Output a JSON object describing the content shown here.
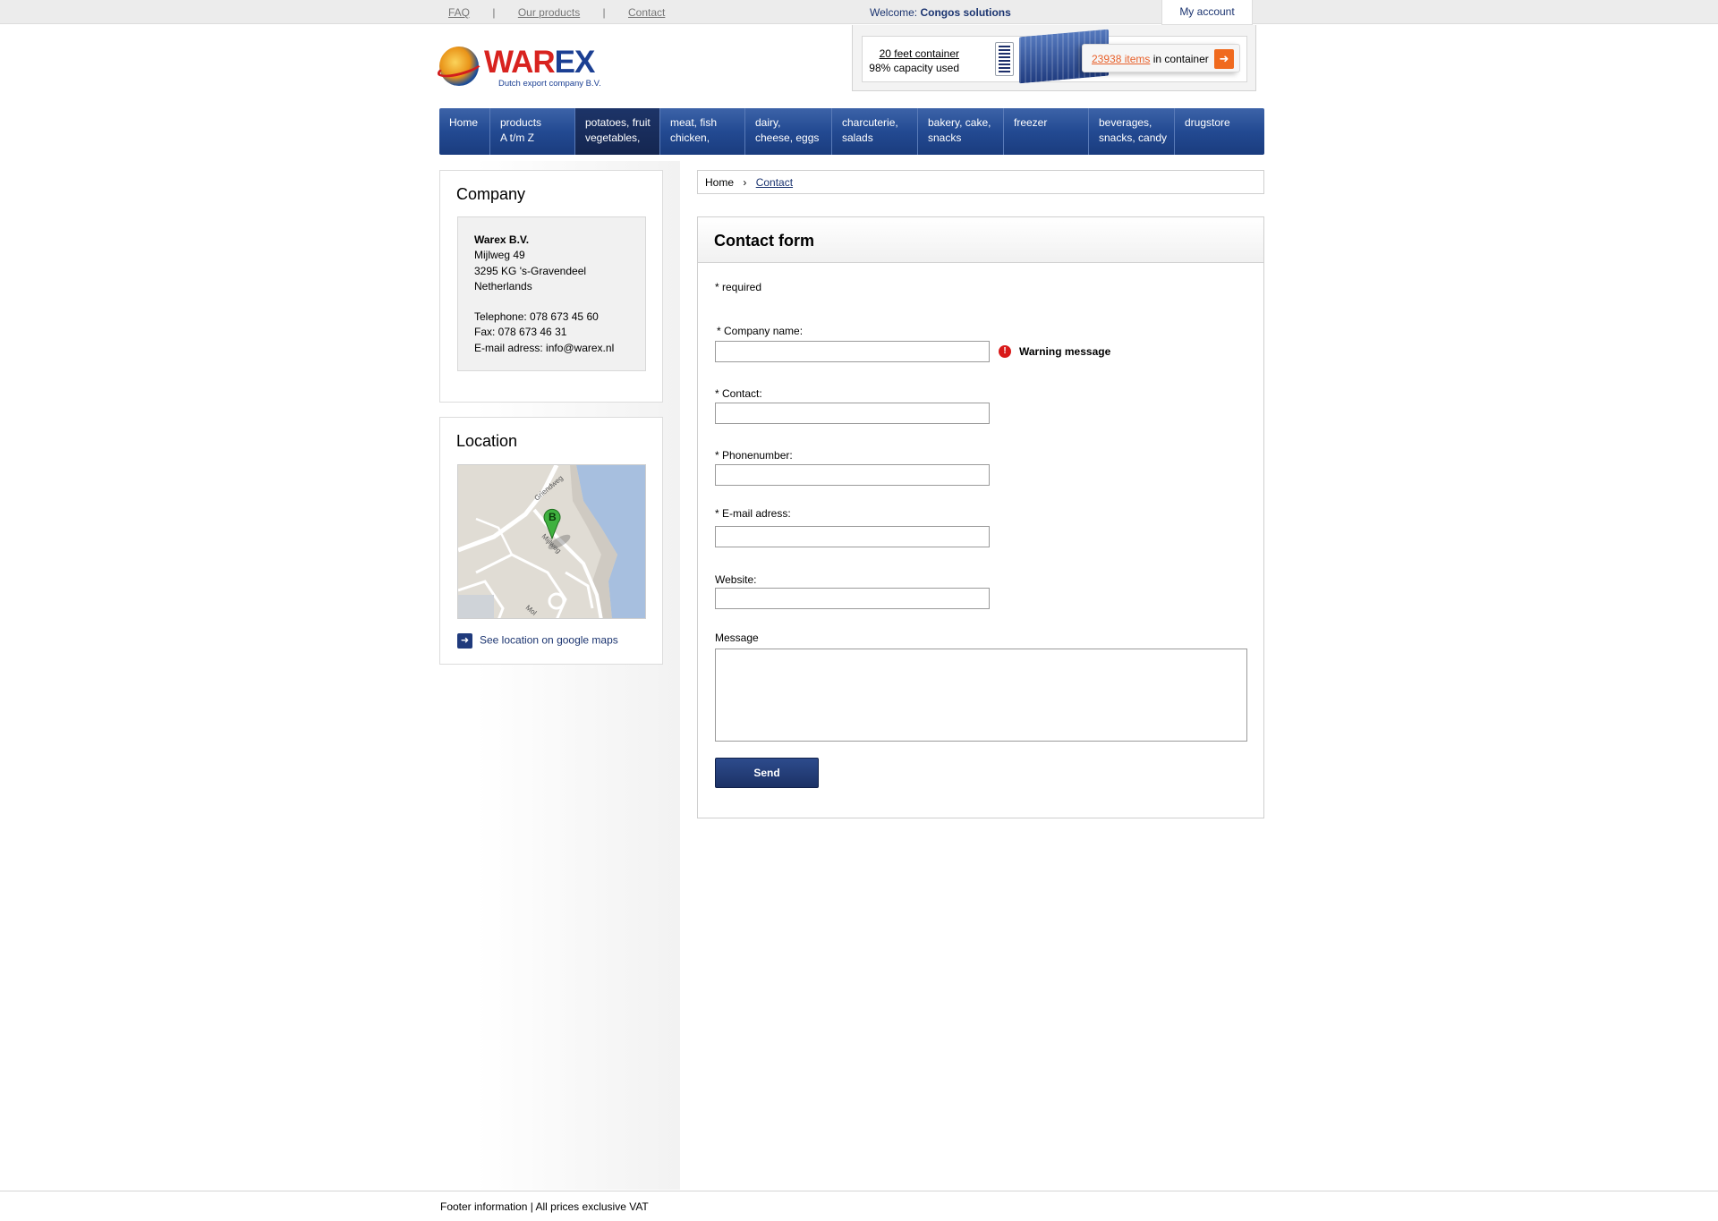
{
  "topbar": {
    "links": [
      "FAQ",
      "Our products",
      "Contact"
    ],
    "separator": "|",
    "welcome_prefix": "Welcome:",
    "welcome_name": "Congos solutions",
    "my_account": "My account"
  },
  "logo": {
    "name_part1": "WAR",
    "name_part2": "EX",
    "tagline": "Dutch export company B.V."
  },
  "container": {
    "name": "20 feet container",
    "capacity": "98% capacity used",
    "capacity_fraction": 0.98,
    "items_count": "23938 items",
    "items_suffix": "in container",
    "arrow_icon": "arrow-right-icon"
  },
  "nav": [
    {
      "line1": "Home",
      "line2": ""
    },
    {
      "line1": "products",
      "line2": "A t/m Z"
    },
    {
      "line1": "potatoes, fruit",
      "line2": "vegetables,"
    },
    {
      "line1": "meat, fish",
      "line2": "chicken,"
    },
    {
      "line1": "dairy,",
      "line2": "cheese, eggs"
    },
    {
      "line1": "charcuterie,",
      "line2": "salads"
    },
    {
      "line1": "bakery, cake,",
      "line2": "snacks"
    },
    {
      "line1": "freezer",
      "line2": ""
    },
    {
      "line1": "beverages,",
      "line2": "snacks, candy"
    },
    {
      "line1": "drugstore",
      "line2": ""
    }
  ],
  "company": {
    "title": "Company",
    "name": "Warex B.V.",
    "street": "Mijlweg 49",
    "city": "3295 KG 's-Gravendeel",
    "country": "Netherlands",
    "telephone": "Telephone: 078 673 45 60",
    "fax": "Fax: 078 673 46 31",
    "email": "E-mail adress: info@warex.nl"
  },
  "location": {
    "title": "Location",
    "map_marker": "B",
    "street_labels": [
      "Griendweg",
      "Mijlweg",
      "Mol"
    ],
    "link": "See location on google maps"
  },
  "breadcrumb": {
    "home": "Home",
    "current": "Contact"
  },
  "form": {
    "title": "Contact form",
    "required_note": "* required",
    "warning": "Warning message",
    "fields": [
      {
        "label": "* Company name:",
        "value": ""
      },
      {
        "label": "* Contact:",
        "value": ""
      },
      {
        "label": "* Phonenumber:",
        "value": ""
      },
      {
        "label": "* E-mail adress:",
        "value": ""
      },
      {
        "label": "Website:",
        "value": ""
      }
    ],
    "message_label": "Message",
    "message_value": "",
    "send": "Send"
  },
  "footer": "Footer information | All prices exclusive VAT",
  "colors": {
    "nav_blue": "#234a92",
    "accent_orange": "#f06a1e",
    "warning_red": "#d91a1a"
  }
}
